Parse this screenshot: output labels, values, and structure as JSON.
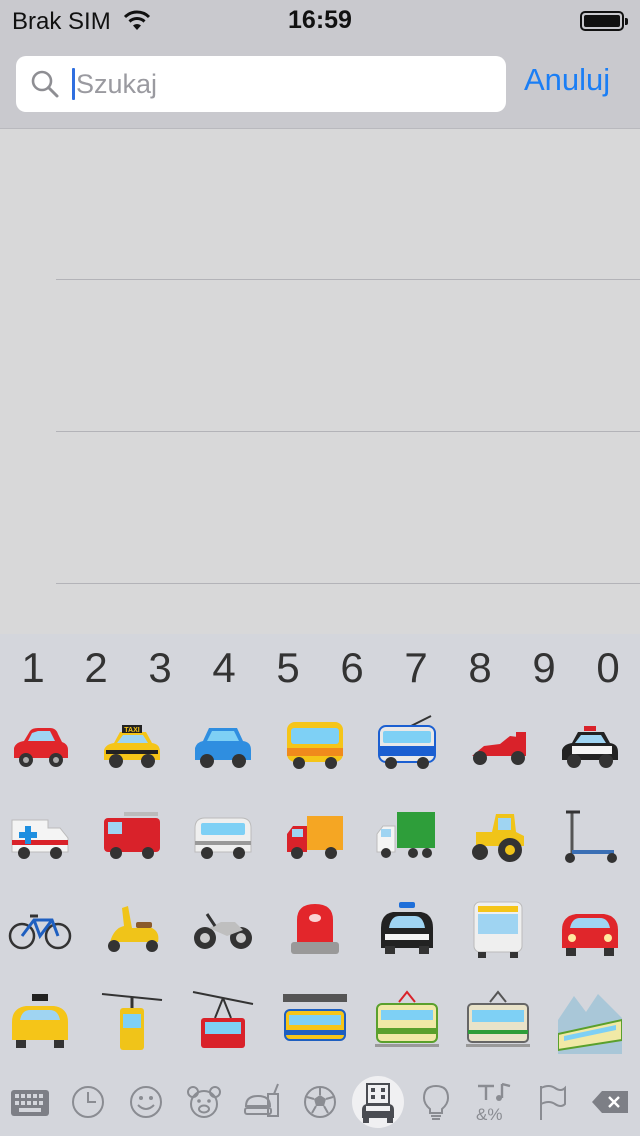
{
  "status_bar": {
    "carrier": "Brak SIM",
    "time": "16:59",
    "wifi_icon": "wifi-icon",
    "battery_icon": "battery-icon"
  },
  "search": {
    "placeholder": "Szukaj",
    "value": "",
    "cancel_label": "Anuluj"
  },
  "colors": {
    "accent": "#1a7ef5",
    "keyboard_bg": "#d4d6dc",
    "results_bg": "#d8d8d9"
  },
  "keyboard": {
    "digits": [
      "1",
      "2",
      "3",
      "4",
      "5",
      "6",
      "7",
      "8",
      "9",
      "0"
    ],
    "emoji_rows": [
      [
        "automobile",
        "taxi",
        "blue-car",
        "bus",
        "trolleybus",
        "racing-car",
        "police-car"
      ],
      [
        "ambulance",
        "fire-engine",
        "minibus",
        "delivery-truck",
        "articulated-lorry",
        "tractor",
        "kick-scooter"
      ],
      [
        "bicycle",
        "motor-scooter",
        "motorcycle",
        "police-light",
        "oncoming-police-car",
        "oncoming-bus",
        "oncoming-automobile"
      ],
      [
        "oncoming-taxi",
        "aerial-tramway",
        "mountain-cableway",
        "suspension-railway",
        "tram-car",
        "railway-car",
        "mountain-railway"
      ]
    ],
    "emoji_labels": {
      "taxi": "TAXI"
    },
    "category_tabs": [
      {
        "icon": "keyboard-icon",
        "active": false
      },
      {
        "icon": "recent-clock-icon",
        "active": false
      },
      {
        "icon": "smiley-icon",
        "active": false
      },
      {
        "icon": "bear-icon",
        "active": false
      },
      {
        "icon": "food-icon",
        "active": false
      },
      {
        "icon": "soccer-ball-icon",
        "active": false
      },
      {
        "icon": "travel-building-car-icon",
        "active": true
      },
      {
        "icon": "lightbulb-icon",
        "active": false
      },
      {
        "icon": "symbols-icon",
        "active": false
      },
      {
        "icon": "flag-icon",
        "active": false
      },
      {
        "icon": "backspace-icon",
        "active": false
      }
    ]
  }
}
